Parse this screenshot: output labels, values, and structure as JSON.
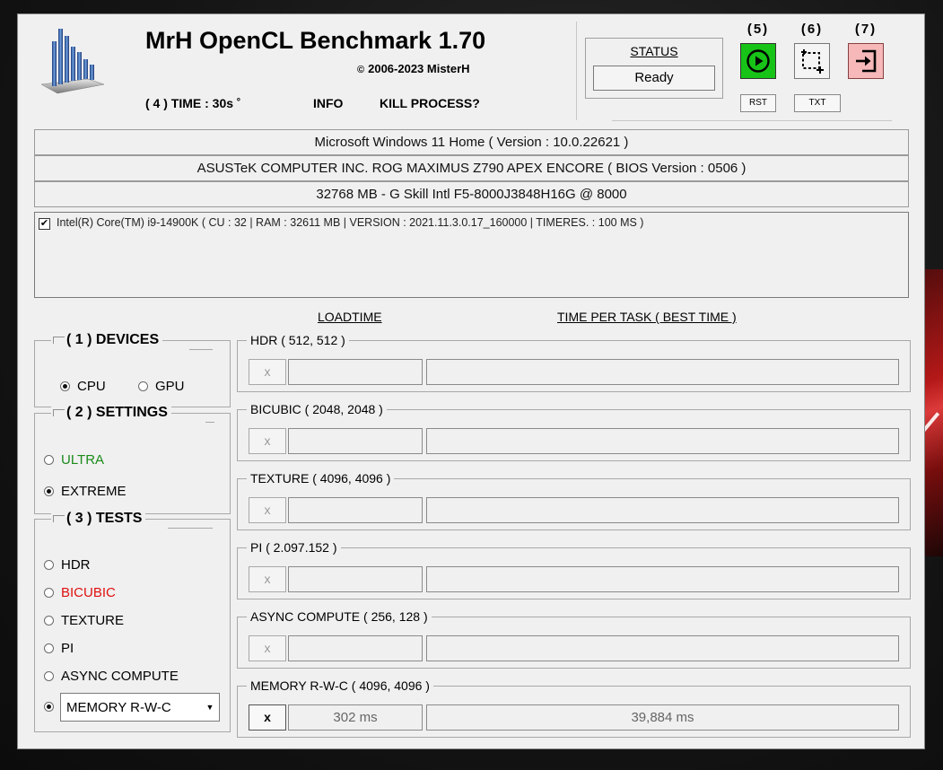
{
  "app": {
    "title": "MrH OpenCL Benchmark 1.70",
    "copyright": "2006-2023 MisterH"
  },
  "menu": {
    "time": "( 4 ) TIME : 30s ˚",
    "info": "INFO",
    "kill": "KILL PROCESS?"
  },
  "status": {
    "label": "STATUS",
    "value": "Ready"
  },
  "toolbar": {
    "run_num": "(5)",
    "shot_num": "(6)",
    "exit_num": "(7)",
    "rst_label": "RST",
    "txt_label": "TXT"
  },
  "system": {
    "os": "Microsoft Windows 11 Home ( Version : 10.0.22621 )",
    "board": "ASUSTeK COMPUTER INC. ROG MAXIMUS Z790 APEX ENCORE ( BIOS Version : 0506 )",
    "memory": "32768 MB - G Skill Intl F5-8000J3848H16G    @ 8000"
  },
  "device_list": [
    {
      "label": "Intel(R) Core(TM) i9-14900K ( CU : 32 | RAM : 32611 MB | VERSION : 2021.11.3.0.17_160000 | TIMERES. : 100 MS )",
      "checked": true
    }
  ],
  "columns": {
    "loadtime": "LOADTIME",
    "time_per_task": "TIME PER TASK ( BEST TIME )"
  },
  "devices": {
    "title": "( 1 ) DEVICES",
    "options": [
      {
        "label": "CPU",
        "selected": true
      },
      {
        "label": "GPU",
        "selected": false
      }
    ]
  },
  "settings": {
    "title": "( 2 ) SETTINGS",
    "options": [
      {
        "label": "ULTRA",
        "selected": false,
        "color": "#1a8a1a"
      },
      {
        "label": "EXTREME",
        "selected": true,
        "color": "#000000"
      }
    ]
  },
  "tests": {
    "title": "( 3 ) TESTS",
    "options": [
      {
        "label": "HDR",
        "selected": false,
        "color": "#000000"
      },
      {
        "label": "BICUBIC",
        "selected": false,
        "color": "#e01010"
      },
      {
        "label": "TEXTURE",
        "selected": false,
        "color": "#000000"
      },
      {
        "label": "PI",
        "selected": false,
        "color": "#000000"
      },
      {
        "label": "ASYNC COMPUTE",
        "selected": false,
        "color": "#000000"
      }
    ],
    "selected_combo": "MEMORY R-W-C"
  },
  "results": [
    {
      "name": "HDR ( 512, 512 )",
      "x": "x",
      "loadtime": "",
      "time": "",
      "active": false
    },
    {
      "name": "BICUBIC ( 2048, 2048 )",
      "x": "x",
      "loadtime": "",
      "time": "",
      "active": false
    },
    {
      "name": "TEXTURE ( 4096, 4096 )",
      "x": "x",
      "loadtime": "",
      "time": "",
      "active": false
    },
    {
      "name": "PI ( 2.097.152 )",
      "x": "x",
      "loadtime": "",
      "time": "",
      "active": false
    },
    {
      "name": "ASYNC COMPUTE ( 256, 128 )",
      "x": "x",
      "loadtime": "",
      "time": "",
      "active": false
    },
    {
      "name": "MEMORY R-W-C ( 4096, 4096 )",
      "x": "x",
      "loadtime": "302 ms",
      "time": "39,884 ms",
      "active": true
    }
  ],
  "colors": {
    "run_button": "#17c317",
    "exit_button": "#f6b8b8"
  }
}
